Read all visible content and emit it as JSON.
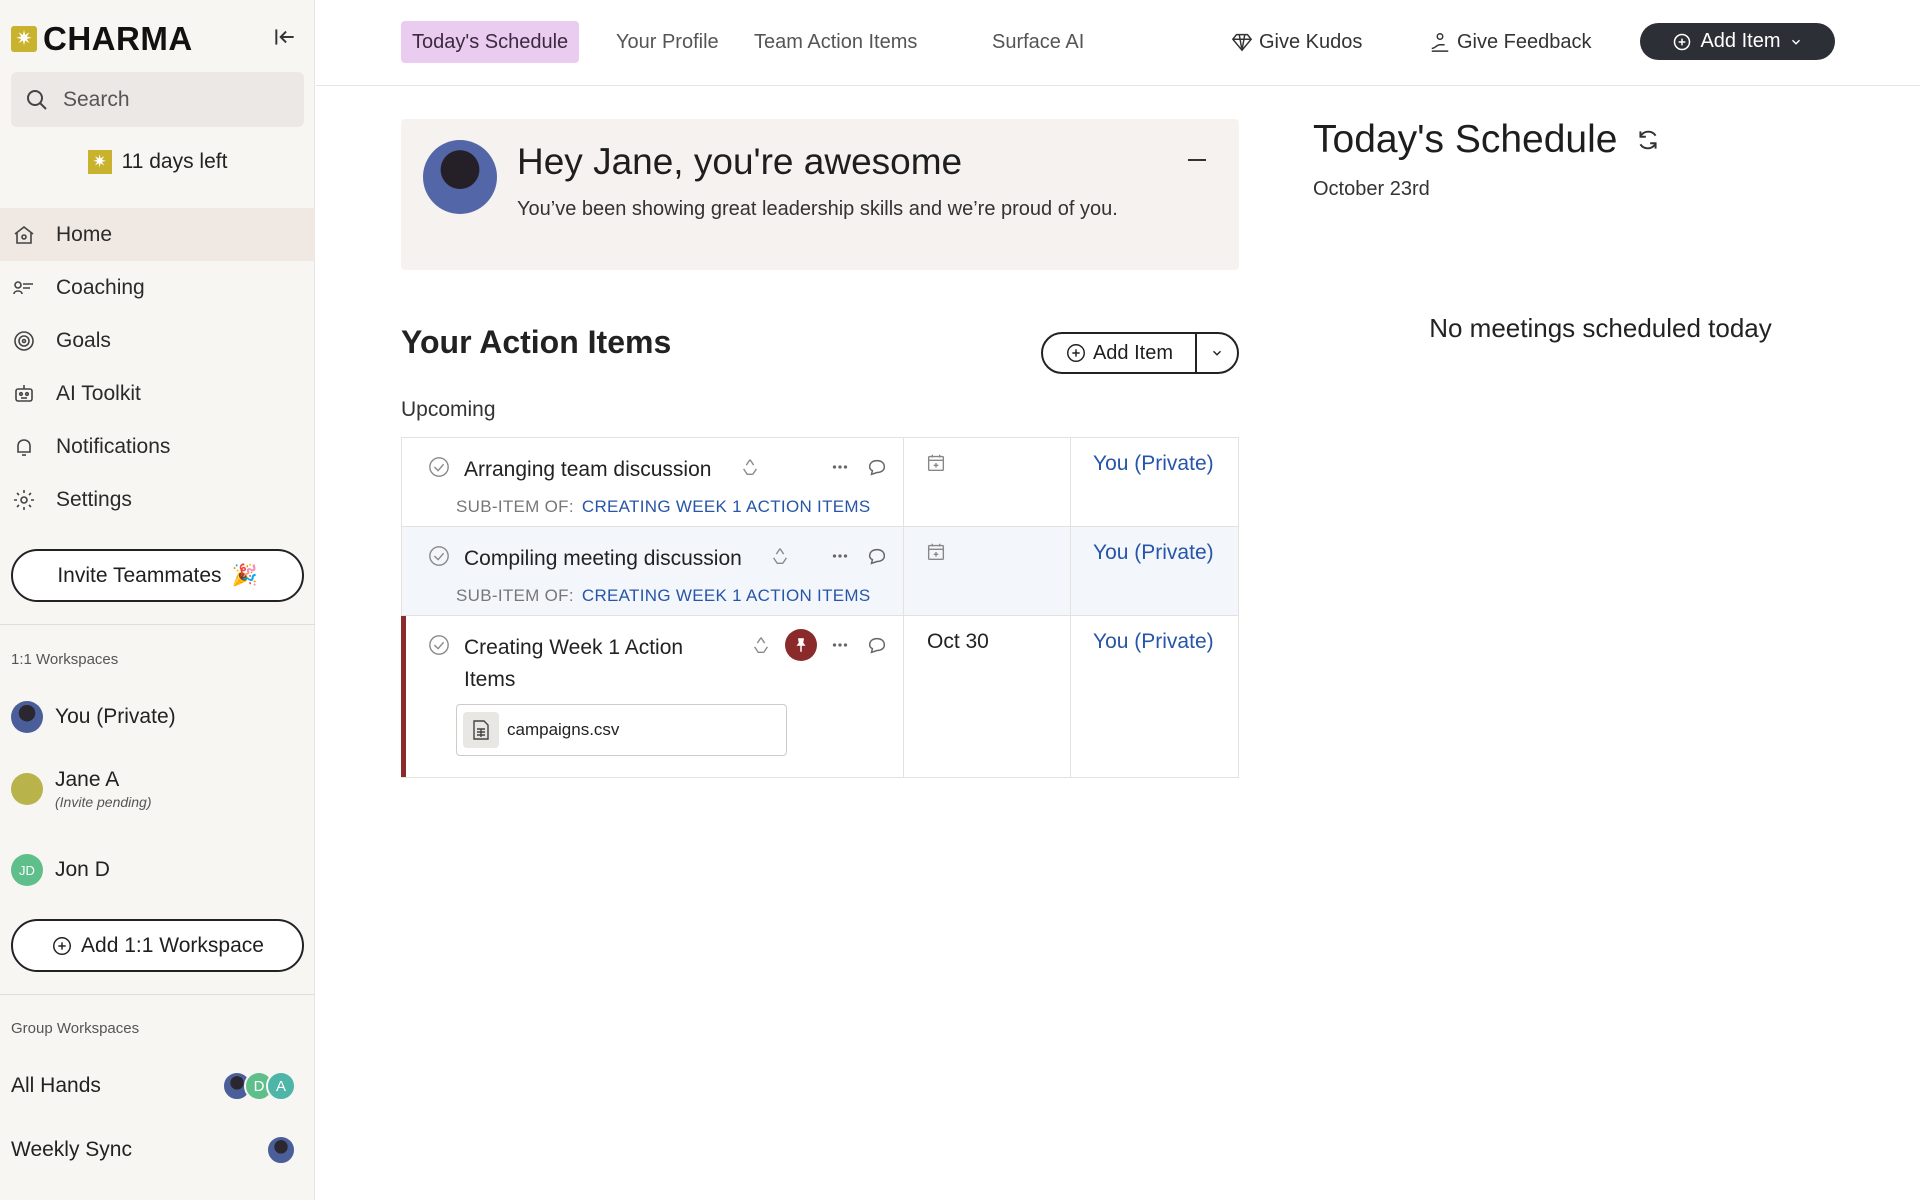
{
  "brand": {
    "name": "CHARMA",
    "accent": "#c9b32e"
  },
  "sidebar": {
    "search_placeholder": "Search",
    "trial_text": "11 days left",
    "nav": [
      {
        "label": "Home",
        "icon": "home-icon",
        "active": true
      },
      {
        "label": "Coaching",
        "icon": "coaching-icon"
      },
      {
        "label": "Goals",
        "icon": "target-icon"
      },
      {
        "label": "AI Toolkit",
        "icon": "robot-icon"
      },
      {
        "label": "Notifications",
        "icon": "bell-icon"
      },
      {
        "label": "Settings",
        "icon": "gear-icon"
      }
    ],
    "invite_label": "Invite Teammates",
    "one_on_one_label": "1:1 Workspaces",
    "workspaces": [
      {
        "name": "You (Private)"
      },
      {
        "name": "Jane A",
        "note": "(Invite pending)"
      },
      {
        "name": "Jon D",
        "initials": "JD"
      }
    ],
    "add_workspace_label": "Add 1:1 Workspace",
    "group_label": "Group Workspaces",
    "groups": [
      {
        "name": "All Hands",
        "members": [
          "",
          "D",
          "A"
        ]
      },
      {
        "name": "Weekly Sync"
      }
    ]
  },
  "topbar": {
    "tabs": [
      "Today's Schedule",
      "Your Profile",
      "Team Action Items",
      "Surface AI"
    ],
    "kudos_label": "Give Kudos",
    "feedback_label": "Give Feedback",
    "add_item_label": "Add Item"
  },
  "kudos_card": {
    "heading": "Hey Jane, you're awesome",
    "message": "You’ve been showing great leadership skills and we’re proud of you."
  },
  "action_items": {
    "title": "Your Action Items",
    "add_label": "Add Item",
    "section": "Upcoming",
    "rows": [
      {
        "title": "Arranging team discussion",
        "sub_prefix": "SUB-ITEM OF:",
        "sub_link": "CREATING WEEK 1 ACTION ITEMS",
        "date": "",
        "assignee": "You (Private)"
      },
      {
        "title": "Compiling meeting discussion",
        "sub_prefix": "SUB-ITEM OF:",
        "sub_link": "CREATING WEEK 1 ACTION ITEMS",
        "date": "",
        "assignee": "You (Private)"
      },
      {
        "title_line1": "Creating Week 1 Action",
        "title_line2": "Items",
        "date": "Oct 30",
        "assignee": "You (Private)",
        "attachment": "campaigns.csv",
        "pinned": true
      }
    ]
  },
  "schedule": {
    "title": "Today's Schedule",
    "date": "October 23rd",
    "empty_text": "No meetings scheduled today"
  }
}
